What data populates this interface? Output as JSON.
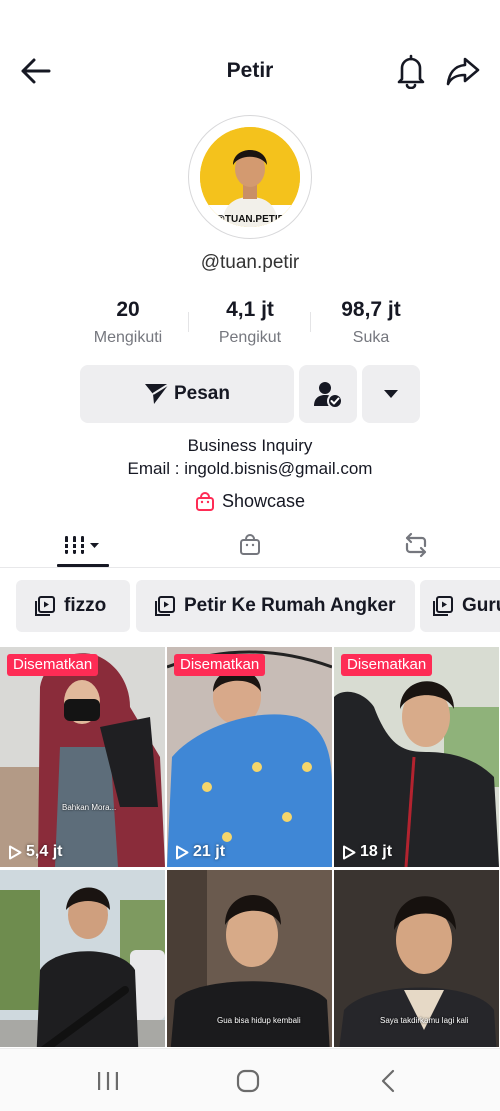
{
  "header": {
    "title": "Petir"
  },
  "profile": {
    "username": "@tuan.petir",
    "avatar_text": "@TUAN.PETIR",
    "stats": [
      {
        "value": "20",
        "label": "Mengikuti"
      },
      {
        "value": "4,1 jt",
        "label": "Pengikut"
      },
      {
        "value": "98,7 jt",
        "label": "Suka"
      }
    ],
    "message_label": "Pesan",
    "bio_line1": "Business Inquiry",
    "bio_line2": "Email : ingold.bisnis@gmail.com",
    "showcase_label": "Showcase"
  },
  "tabs": [
    {
      "icon": "videos-grid-icon",
      "active": true
    },
    {
      "icon": "shop-bag-icon",
      "active": false
    },
    {
      "icon": "repost-icon",
      "active": false
    }
  ],
  "playlists": [
    {
      "label": "fizzo"
    },
    {
      "label": "Petir Ke Rumah Angker"
    },
    {
      "label": "Guru"
    }
  ],
  "videos": [
    {
      "pinned_label": "Disematkan",
      "views": "5,4 jt",
      "caption": "Bahkan Mora..."
    },
    {
      "pinned_label": "Disematkan",
      "views": "21 jt",
      "caption": ""
    },
    {
      "pinned_label": "Disematkan",
      "views": "18 jt",
      "caption": ""
    },
    {
      "pinned_label": "",
      "views": "",
      "caption": ""
    },
    {
      "pinned_label": "",
      "views": "",
      "caption": "Gua bisa hidup kembali"
    },
    {
      "pinned_label": "",
      "views": "",
      "caption": "Saya takdirkamu lagi kali"
    }
  ],
  "colors": {
    "accent": "#fe2c55",
    "text": "#161823",
    "muted": "#75777e",
    "button_bg": "#eeeef0"
  }
}
